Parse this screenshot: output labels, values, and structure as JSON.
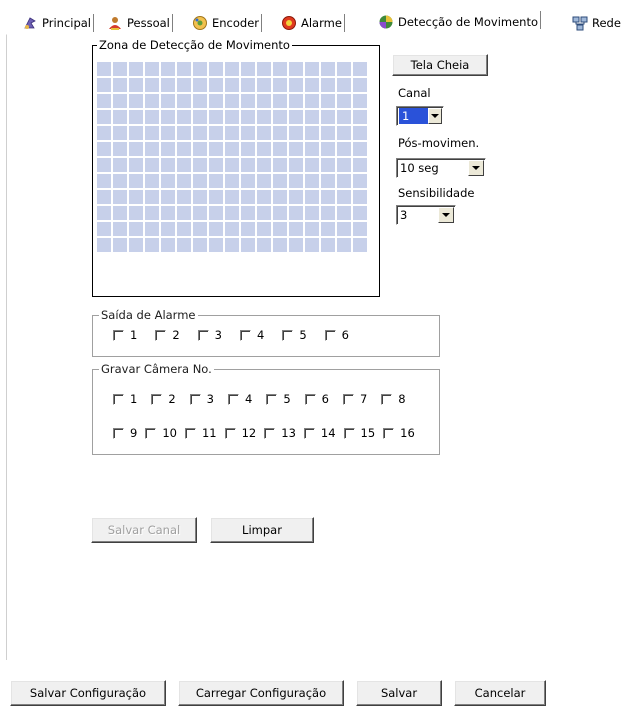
{
  "tabs": [
    {
      "label": "Principal",
      "icon": "principal-icon"
    },
    {
      "label": "Pessoal",
      "icon": "pessoal-icon"
    },
    {
      "label": "Encoder",
      "icon": "encoder-icon"
    },
    {
      "label": "Alarme",
      "icon": "alarm-icon"
    },
    {
      "label": "Detecção de Movimento",
      "icon": "motion-icon"
    },
    {
      "label": "Rede",
      "icon": "network-icon"
    }
  ],
  "zone": {
    "title": "Zona de Detecção de Movimento",
    "columns": 17,
    "rows": 12,
    "cell_color": "#c7d0ea"
  },
  "fullscreen_label": "Tela Cheia",
  "channel": {
    "label": "Canal",
    "value": "1"
  },
  "post_motion": {
    "label": "Pós-movimen.",
    "value": "10 seg"
  },
  "sensitivity": {
    "label": "Sensibilidade",
    "value": "3"
  },
  "alarm_output": {
    "title": "Saída de Alarme",
    "items": [
      "1",
      "2",
      "3",
      "4",
      "5",
      "6"
    ]
  },
  "record_camera": {
    "title": "Gravar Câmera No.",
    "row1": [
      "1",
      "2",
      "3",
      "4",
      "5",
      "6",
      "7",
      "8"
    ],
    "row2": [
      "9",
      "10",
      "11",
      "12",
      "13",
      "14",
      "15",
      "16"
    ]
  },
  "save_channel_label": "Salvar Canal",
  "clear_label": "Limpar",
  "bottom_buttons": {
    "save_config": "Salvar Configuração",
    "load_config": "Carregar Configuração",
    "save": "Salvar",
    "cancel": "Cancelar"
  }
}
